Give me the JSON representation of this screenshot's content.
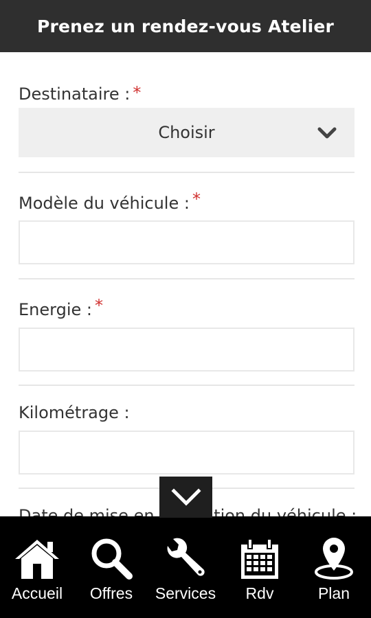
{
  "header": {
    "title": "Prenez un rendez-vous Atelier"
  },
  "form": {
    "required_marker": "*",
    "recipient": {
      "label": "Destinataire :",
      "selected_value": "Choisir"
    },
    "vehicle_model": {
      "label": "Modèle du véhicule :",
      "value": ""
    },
    "energy": {
      "label": "Energie :",
      "value": ""
    },
    "mileage": {
      "label": "Kilométrage :",
      "value": ""
    },
    "registration_date": {
      "label": "Date de mise en circulation du véhicule :"
    }
  },
  "scroll_button": {
    "icon": "chevron-down-icon"
  },
  "nav": {
    "items": [
      {
        "label": "Accueil",
        "icon": "home-icon"
      },
      {
        "label": "Offres",
        "icon": "search-icon"
      },
      {
        "label": "Services",
        "icon": "wrench-icon"
      },
      {
        "label": "Rdv",
        "icon": "calendar-icon"
      },
      {
        "label": "Plan",
        "icon": "map-pin-icon"
      }
    ]
  },
  "colors": {
    "header_bg": "#2f2f2f",
    "nav_bg": "#000000",
    "required": "#d0302f",
    "select_bg": "#efefef"
  }
}
